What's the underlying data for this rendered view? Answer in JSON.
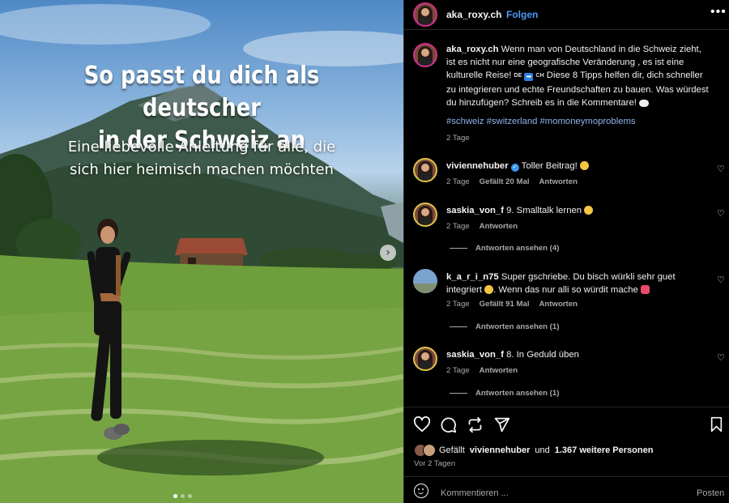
{
  "post": {
    "overlay_title_line1": "So passt du dich als deutscher",
    "overlay_title_line2": "in der Schweiz an",
    "overlay_sub_line1": "Eine liebevolle Anleitung für alle, die",
    "overlay_sub_line2": "sich hier heimisch machen möchten",
    "next_arrow": "›"
  },
  "header": {
    "username": "aka_roxy.ch",
    "separator": "•",
    "follow_label": "Folgen",
    "more": "•••"
  },
  "caption": {
    "username": "aka_roxy.ch",
    "text_a": "Wenn man von Deutschland in die Schweiz zieht, ist es nicht nur eine geografische Veränderung , es ist eine kulturelle Reise! ",
    "flag_de": "DE",
    "arrow": "➡",
    "flag_ch": "CH",
    "text_b": " Diese 8 Tipps helfen dir, dich schneller zu integrieren und echte Freundschaften zu bauen. Was würdest du hinzufügen? Schreib es in die Kommentare! ",
    "hashtags": "#schweiz #switzerland #momoneymoproblems",
    "time": "2 Tage"
  },
  "comments": [
    {
      "username": "viviennehuber",
      "verified": "✓",
      "text": "Toller Beitrag! ",
      "time": "2 Tage",
      "likes": "Gefällt 20 Mal",
      "reply": "Antworten"
    },
    {
      "username": "saskia_von_f",
      "text": "9. Smalltalk lernen ",
      "time": "2 Tage",
      "reply": "Antworten",
      "view_replies": "Antworten ansehen (4)"
    },
    {
      "username": "k_a_r_i_n75",
      "text": "Super gschriebe. Du bisch würkli sehr guet integriert ",
      "text_after": ". Wenn das nur alli so würdit mache ",
      "time": "2 Tage",
      "likes": "Gefällt 91 Mal",
      "reply": "Antworten",
      "view_replies": "Antworten ansehen (1)"
    },
    {
      "username": "saskia_von_f",
      "text": "8. In Geduld üben",
      "time": "2 Tage",
      "reply": "Antworten",
      "view_replies": "Antworten ansehen (1)"
    }
  ],
  "likes_line": {
    "prefix": "Gefällt",
    "user": "viviennehuber",
    "middle": "und",
    "count": "1.367 weitere Personen"
  },
  "ago": "Vor 2 Tagen",
  "compose": {
    "placeholder": "Kommentieren ...",
    "post_label": "Posten"
  },
  "colors": {
    "link_blue": "#4a9df6",
    "hashtag": "#8fb3f0",
    "muted": "#a8a8a8",
    "story_ring": "#d12f8a"
  },
  "icons": [
    "heart-icon",
    "comment-icon",
    "repost-icon",
    "share-icon",
    "bookmark-icon",
    "smiley-icon",
    "more-icon",
    "chevron-right-icon",
    "verified-icon"
  ]
}
